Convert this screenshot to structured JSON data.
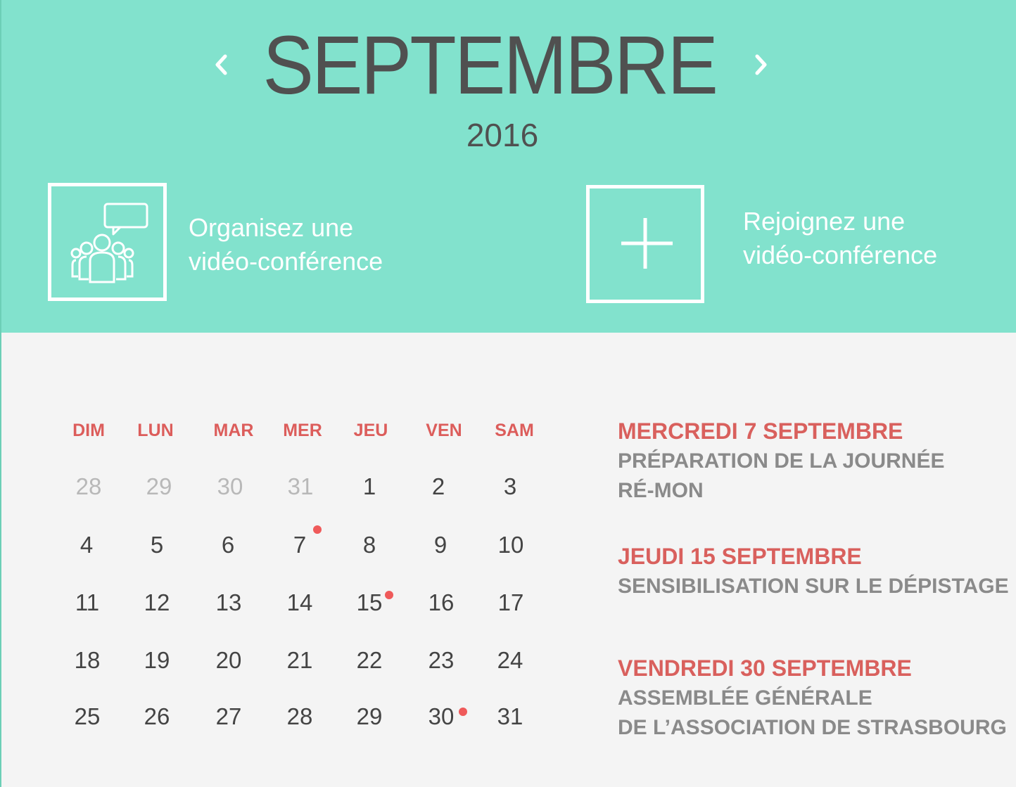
{
  "header": {
    "month": "SEPTEMBRE",
    "year": "2016",
    "prev_icon": "chevron-left-icon",
    "next_icon": "chevron-right-icon",
    "background_color": "#82e2cd"
  },
  "actions": [
    {
      "icon": "people-chat-icon",
      "line1": "Organisez une",
      "line2": "vidéo-conférence"
    },
    {
      "icon": "plus-icon",
      "line1": "Rejoignez une",
      "line2": "vidéo-conférence"
    }
  ],
  "calendar": {
    "weekdays": [
      "DIM",
      "LUN",
      "MAR",
      "MER",
      "JEU",
      "VEN",
      "SAM"
    ],
    "weeks": [
      [
        "28",
        "29",
        "30",
        "31",
        "1",
        "2",
        "3"
      ],
      [
        "4",
        "5",
        "6",
        "7",
        "8",
        "9",
        "10"
      ],
      [
        "11",
        "12",
        "13",
        "14",
        "15",
        "16",
        "17"
      ],
      [
        "18",
        "19",
        "20",
        "21",
        "22",
        "23",
        "24"
      ],
      [
        "25",
        "26",
        "27",
        "28",
        "29",
        "30",
        "31"
      ]
    ],
    "accent_color": "#dc5d5b",
    "event_dot_color": "#ef5a5a"
  },
  "events": [
    {
      "date": "MERCREDI 7 SEPTEMBRE",
      "desc1": "PRÉPARATION DE LA JOURNÉE",
      "desc2": "RÉ-MON"
    },
    {
      "date": "JEUDI 15 SEPTEMBRE",
      "desc1": "SENSIBILISATION SUR LE DÉPISTAGE"
    },
    {
      "date": "VENDREDI 30 SEPTEMBRE",
      "desc1": "ASSEMBLÉE GÉNÉRALE",
      "desc2": "DE L’ASSOCIATION DE STRASBOURG"
    }
  ]
}
